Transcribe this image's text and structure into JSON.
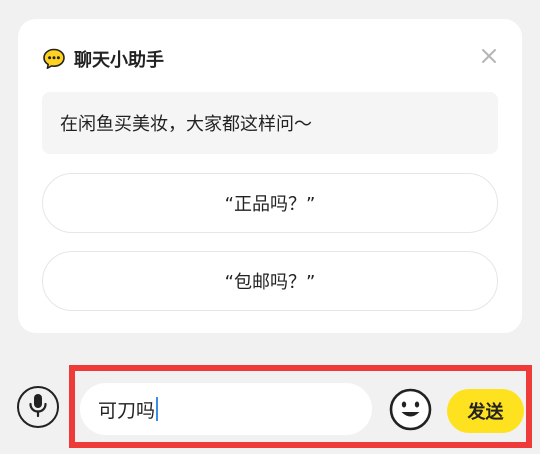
{
  "assistant": {
    "title": "聊天小助手",
    "tip": "在闲鱼买美妆，大家都这样问～",
    "suggestions": [
      "“正品吗？”",
      "“包邮吗？”"
    ],
    "icon": "chat-bubble-icon",
    "accent_color": "#ffd21f"
  },
  "composer": {
    "input_value": "可刀吗",
    "send_label": "发送",
    "send_color": "#ffe21f",
    "highlight_color": "#ef3a3a"
  }
}
